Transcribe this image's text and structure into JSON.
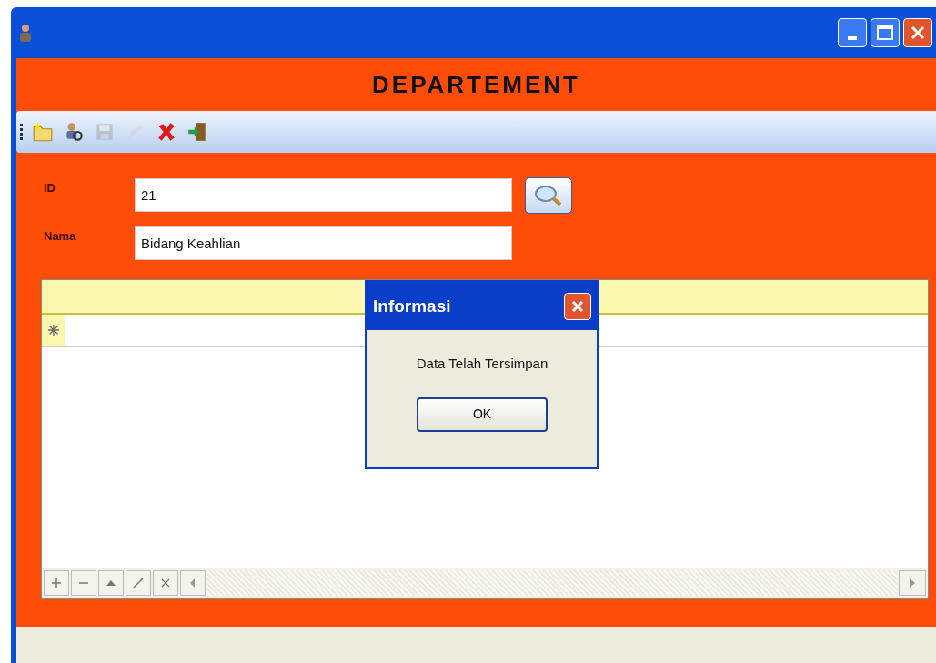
{
  "heading": "DEPARTEMENT",
  "toolbar": [
    {
      "kind": "new",
      "disabled": false
    },
    {
      "kind": "search",
      "disabled": false
    },
    {
      "kind": "save",
      "disabled": true
    },
    {
      "kind": "edit",
      "disabled": true
    },
    {
      "kind": "delete",
      "disabled": false
    },
    {
      "kind": "exit",
      "disabled": false
    }
  ],
  "fields": [
    {
      "label": "ID",
      "value": "21",
      "search_button": true
    },
    {
      "label": "Nama",
      "value": "Bidang Keahlian",
      "search_button": false
    }
  ],
  "dialog": {
    "title": "Informasi",
    "message": "Data Telah Tersimpan",
    "button": "OK"
  }
}
